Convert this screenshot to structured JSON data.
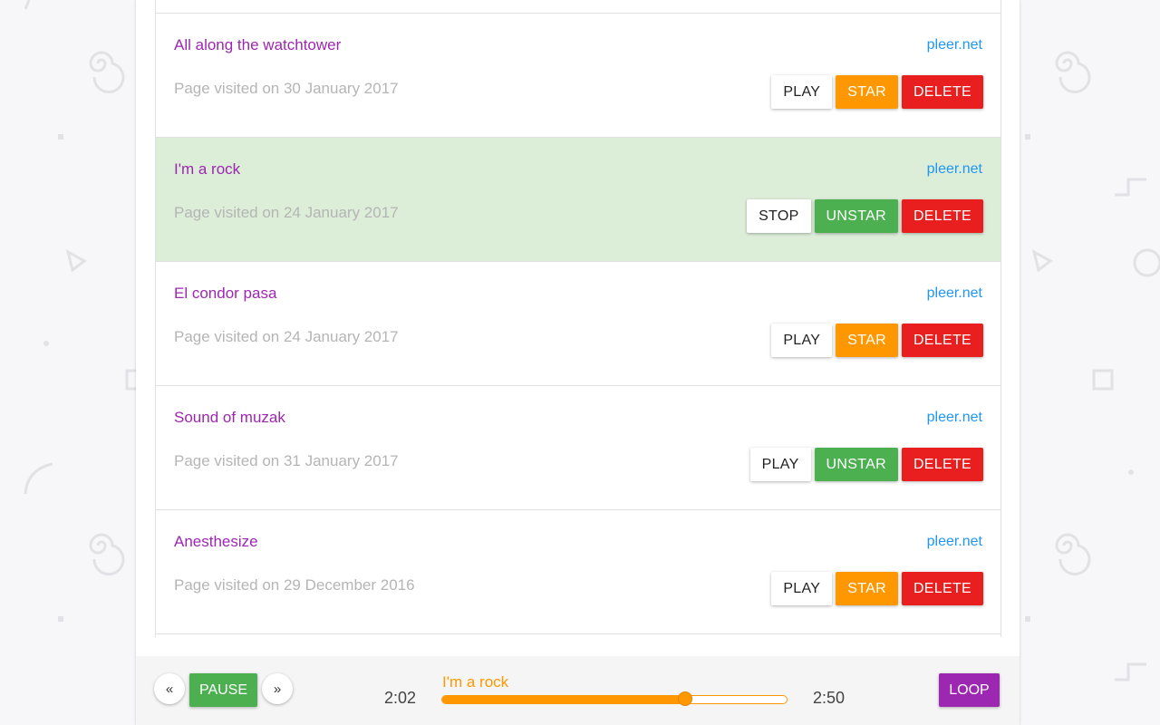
{
  "tracks": [
    {
      "title": "All along the watchtower",
      "source": "pleer.net",
      "visited": "Page visited on 30 January 2017",
      "play_label": "PLAY",
      "star_label": "STAR",
      "delete_label": "DELETE",
      "active": false,
      "starred": false
    },
    {
      "title": "I'm a rock",
      "source": "pleer.net",
      "visited": "Page visited on 24 January 2017",
      "play_label": "STOP",
      "star_label": "UNSTAR",
      "delete_label": "DELETE",
      "active": true,
      "starred": true
    },
    {
      "title": "El condor pasa",
      "source": "pleer.net",
      "visited": "Page visited on 24 January 2017",
      "play_label": "PLAY",
      "star_label": "STAR",
      "delete_label": "DELETE",
      "active": false,
      "starred": false
    },
    {
      "title": "Sound of muzak",
      "source": "pleer.net",
      "visited": "Page visited on 31 January 2017",
      "play_label": "PLAY",
      "star_label": "UNSTAR",
      "delete_label": "DELETE",
      "active": false,
      "starred": true
    },
    {
      "title": "Anesthesize",
      "source": "pleer.net",
      "visited": "Page visited on 29 December 2016",
      "play_label": "PLAY",
      "star_label": "STAR",
      "delete_label": "DELETE",
      "active": false,
      "starred": false
    }
  ],
  "player": {
    "prev_label": "«",
    "pause_label": "PAUSE",
    "next_label": "»",
    "elapsed": "2:02",
    "duration": "2:50",
    "now_playing": "I'm a rock",
    "progress": 0.705,
    "loop_label": "LOOP"
  },
  "colors": {
    "accent_purple": "#9c27b0",
    "link_blue": "#2196f3",
    "star_orange": "#ff9800",
    "unstar_green": "#4caf50",
    "delete_red": "#e91e1e",
    "active_row": "#dcedd8"
  }
}
